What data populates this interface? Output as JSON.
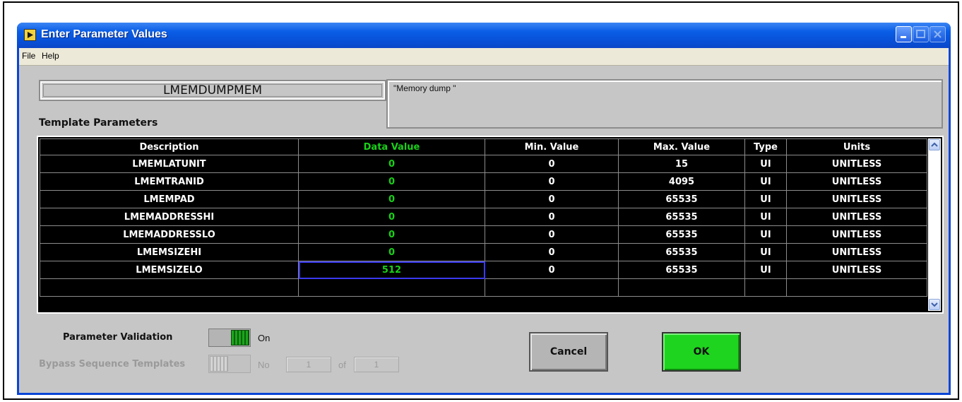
{
  "window": {
    "title": "Enter Parameter Values"
  },
  "menu": {
    "items": [
      "File",
      "Help"
    ]
  },
  "template": {
    "name": "LMEMDUMPMEM",
    "description": "\"Memory dump \""
  },
  "section_label": "Template Parameters",
  "table": {
    "columns": [
      "Description",
      "Data Value",
      "Min. Value",
      "Max. Value",
      "Type",
      "Units"
    ],
    "rows": [
      [
        "LMEMLATUNIT",
        "0",
        "0",
        "15",
        "UI",
        "UNITLESS"
      ],
      [
        "LMEMTRANID",
        "0",
        "0",
        "4095",
        "UI",
        "UNITLESS"
      ],
      [
        "LMEMPAD",
        "0",
        "0",
        "65535",
        "UI",
        "UNITLESS"
      ],
      [
        "LMEMADDRESSHI",
        "0",
        "0",
        "65535",
        "UI",
        "UNITLESS"
      ],
      [
        "LMEMADDRESSLO",
        "0",
        "0",
        "65535",
        "UI",
        "UNITLESS"
      ],
      [
        "LMEMSIZEHI",
        "0",
        "0",
        "65535",
        "UI",
        "UNITLESS"
      ],
      [
        "LMEMSIZELO",
        "512",
        "0",
        "65535",
        "UI",
        "UNITLESS"
      ],
      [
        "",
        "",
        "",
        "",
        "",
        ""
      ]
    ],
    "selected_row": 6
  },
  "validation": {
    "label": "Parameter Validation",
    "state": "On"
  },
  "bypass": {
    "label": "Bypass Sequence Templates",
    "state": "No",
    "current": "1",
    "of_label": "of",
    "total": "1"
  },
  "buttons": {
    "cancel": "Cancel",
    "ok": "OK"
  },
  "colors": {
    "title_bar": "#0a5ee6",
    "data_value_text": "#19d119",
    "ok_button": "#1fd41f",
    "dialog_bg": "#c6c6c6"
  }
}
